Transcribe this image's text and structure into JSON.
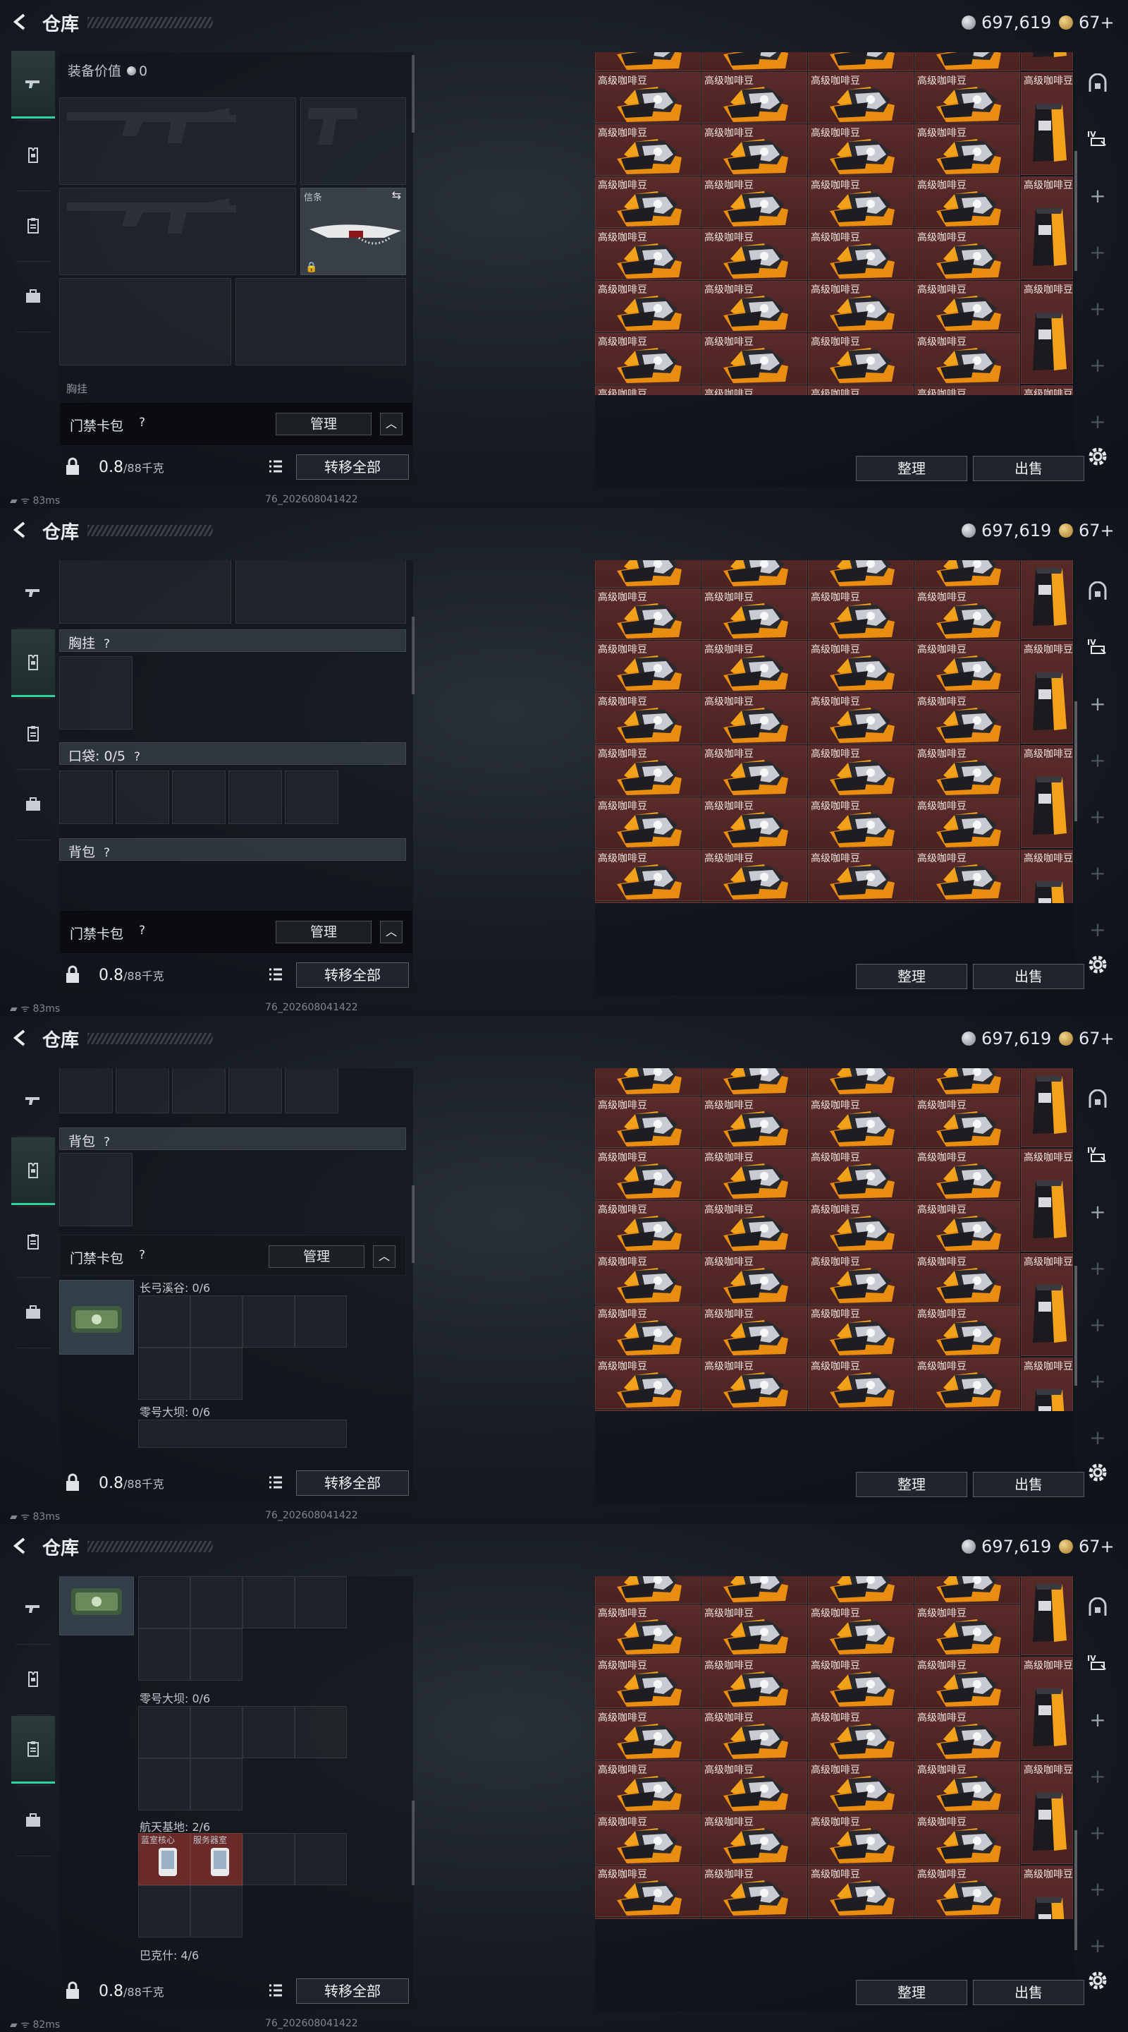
{
  "title": "仓库",
  "currency": {
    "silver": "697,619",
    "gold": "67+"
  },
  "equip_value_label": "装备价值",
  "equip_value": "0",
  "knife_label": "信条",
  "chest_label": "胸挂",
  "pocket_label": "口袋: 0/5",
  "backpack_label": "背包",
  "keycard_label": "门禁卡包",
  "manage_label": "管理",
  "weight": "0.8",
  "weight_max": "/88千克",
  "transfer_label": "转移全部",
  "sort_label": "整理",
  "sell_label": "出售",
  "item_name": "高级咖啡豆",
  "chest_cutoff": "胸挂",
  "keycards": {
    "k1": "长弓溪谷: 0/6",
    "k2": "零号大坝: 0/6",
    "k3": "航天基地: 2/6",
    "k4": "巴克什: 4/6",
    "card_a": "蓝室核心",
    "card_b": "服务器室"
  },
  "status": {
    "ping": "83ms",
    "ping_last": "82ms",
    "version": "76_202608041422"
  },
  "colors": {
    "accent": "#2fd2a0",
    "item_bg": "#5a2b2a"
  }
}
